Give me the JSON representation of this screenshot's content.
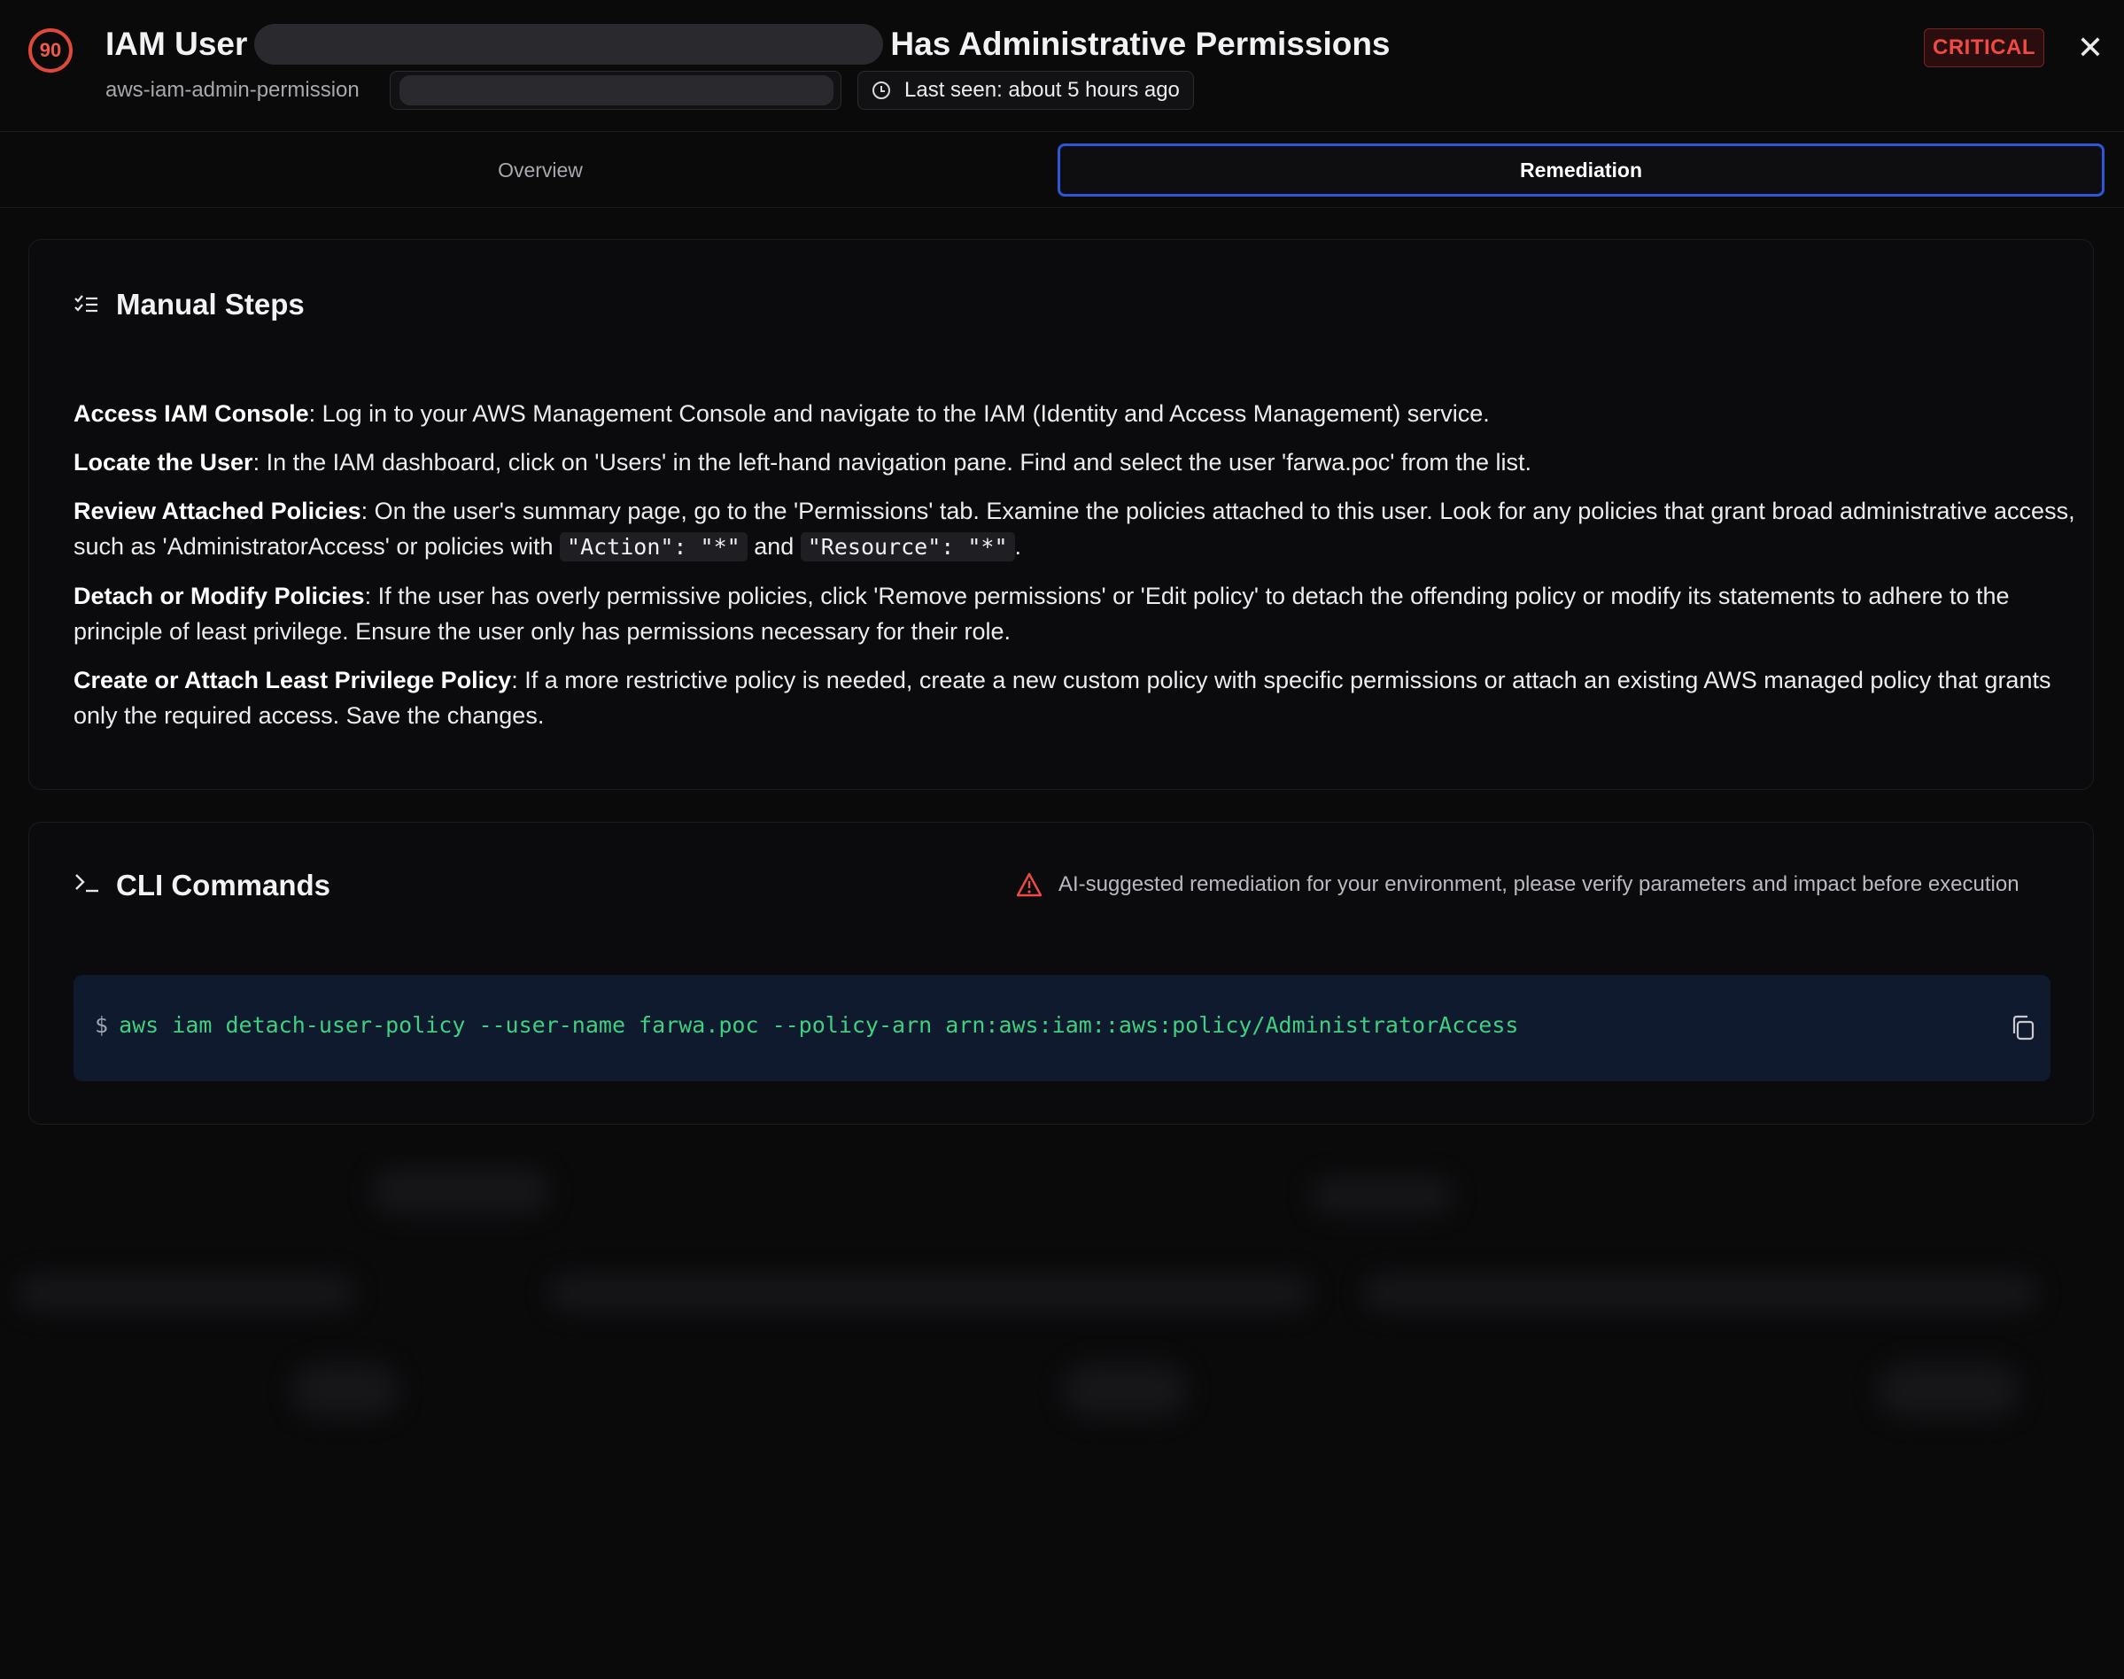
{
  "header": {
    "score": "90",
    "title_prefix": "IAM User",
    "title_suffix": "Has Administrative Permissions",
    "slug": "aws-iam-admin-permission",
    "last_seen": "Last seen: about 5 hours ago",
    "severity": "CRITICAL",
    "close_label": "✕"
  },
  "tabs": [
    {
      "label": "Overview"
    },
    {
      "label": "Remediation"
    }
  ],
  "manual_steps": {
    "title": "Manual Steps",
    "steps": [
      {
        "title": "Access IAM Console",
        "text": ": Log in to your AWS Management Console and navigate to the IAM (Identity and Access Management) service."
      },
      {
        "title": "Locate the User",
        "text": ": In the IAM dashboard, click on 'Users' in the left-hand navigation pane. Find and select the user 'farwa.poc' from the list."
      },
      {
        "title": "Review Attached Policies",
        "text_a": ": On the user's summary page, go to the 'Permissions' tab. Examine the policies attached to this user. Look for any policies that grant broad administrative access, such as 'AdministratorAccess' or policies with ",
        "code_a": "\"Action\": \"*\"",
        "mid": " and ",
        "code_b": "\"Resource\": \"*\"",
        "end": "."
      },
      {
        "title": "Detach or Modify Policies",
        "text": ": If the user has overly permissive policies, click 'Remove permissions' or 'Edit policy' to detach the offending policy or modify its statements to adhere to the principle of least privilege. Ensure the user only has permissions necessary for their role."
      },
      {
        "title": "Create or Attach Least Privilege Policy",
        "text": ": If a more restrictive policy is needed, create a new custom policy with specific permissions or attach an existing AWS managed policy that grants only the required access. Save the changes."
      }
    ]
  },
  "cli": {
    "title": "CLI Commands",
    "warning": "AI-suggested remediation for your environment, please verify parameters and impact before execution",
    "prompt": "$",
    "command": "aws iam detach-user-policy --user-name farwa.poc --policy-arn arn:aws:iam::aws:policy/AdministratorAccess"
  },
  "colors": {
    "accent": "#2f56d8",
    "critical": "#ef4b43",
    "command_text": "#3fcf7e"
  }
}
